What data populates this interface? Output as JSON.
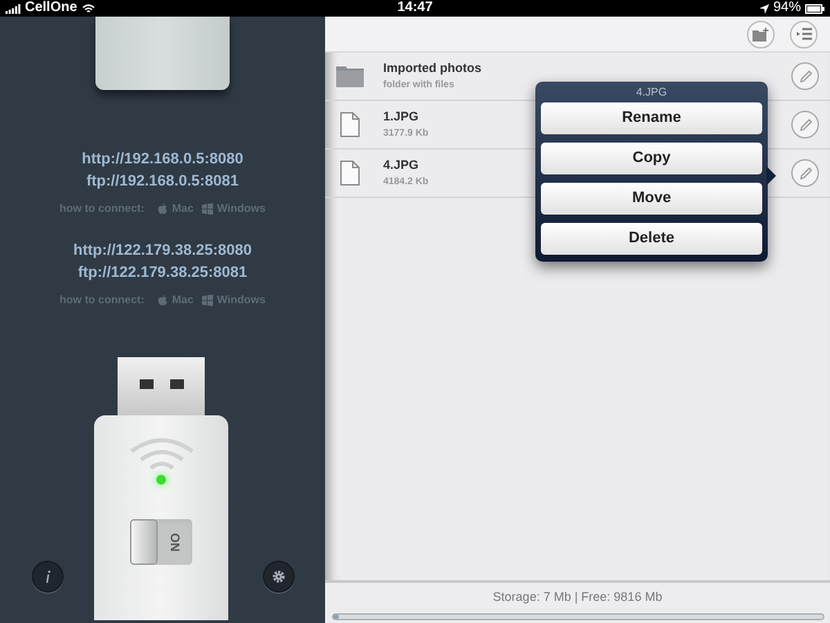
{
  "status_bar": {
    "carrier": "CellOne",
    "time": "14:47",
    "battery": "94%"
  },
  "servers": [
    {
      "http": "http://192.168.0.5:8080",
      "ftp": "ftp://192.168.0.5:8081",
      "how_to": "how to connect:",
      "mac": "Mac",
      "windows": "Windows"
    },
    {
      "http": "http://122.179.38.25:8080",
      "ftp": "ftp://122.179.38.25:8081",
      "how_to": "how to connect:",
      "mac": "Mac",
      "windows": "Windows"
    }
  ],
  "drive": {
    "switch_label": "ON",
    "led_on": true,
    "switch_on": true
  },
  "files": [
    {
      "kind": "folder",
      "name": "Imported photos",
      "detail": "folder with files"
    },
    {
      "kind": "file",
      "name": "1.JPG",
      "detail": "3177.9 Kb"
    },
    {
      "kind": "file",
      "name": "4.JPG",
      "detail": "4184.2 Kb"
    }
  ],
  "popover": {
    "title": "4.JPG",
    "actions": [
      "Rename",
      "Copy",
      "Move",
      "Delete"
    ]
  },
  "storage": {
    "text": "Storage: 7 Mb | Free: 9816 Mb",
    "level": 0.005
  }
}
